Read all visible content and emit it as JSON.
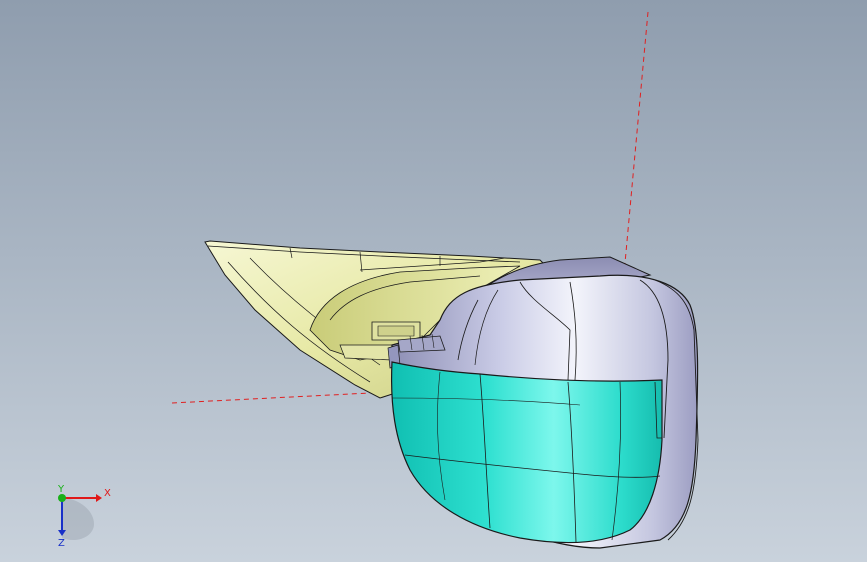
{
  "viewport": {
    "background_top": "#8f9dae",
    "background_bottom": "#c9d2dc"
  },
  "triad": {
    "x_label": "X",
    "y_label": "Y",
    "z_label": "Z",
    "x_color": "#e01818",
    "y_color": "#18b018",
    "z_color": "#1830c8"
  },
  "model": {
    "housing_color": "#d6d8ec",
    "glass_color": "#2fe2d2",
    "bracket_color": "#eef0b0",
    "axis_line_color": "#e02020"
  }
}
